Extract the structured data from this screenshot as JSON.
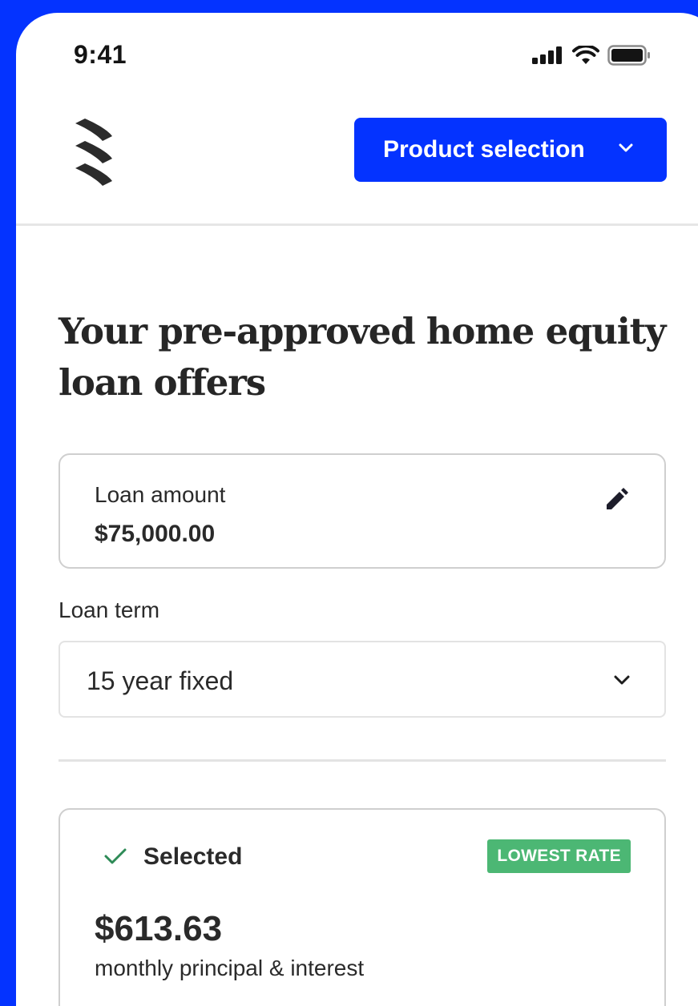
{
  "status_bar": {
    "time": "9:41",
    "icons": [
      "cellular-signal-icon",
      "wifi-icon",
      "battery-icon"
    ]
  },
  "header": {
    "logo": "brand-logo",
    "product_button_label": "Product selection"
  },
  "page": {
    "title": "Your pre-approved home equity loan offers"
  },
  "loan_amount": {
    "label": "Loan amount",
    "value": "$75,000.00"
  },
  "loan_term": {
    "label": "Loan term",
    "selected": "15 year fixed"
  },
  "offer": {
    "status": "Selected",
    "badge": "LOWEST RATE",
    "monthly_payment": "$613.63",
    "payment_description": "monthly principal & interest"
  },
  "colors": {
    "brand_blue": "#0433ff",
    "badge_green": "#4cb774",
    "check_green": "#2e8b57",
    "text_dark": "#2a2a2a"
  }
}
